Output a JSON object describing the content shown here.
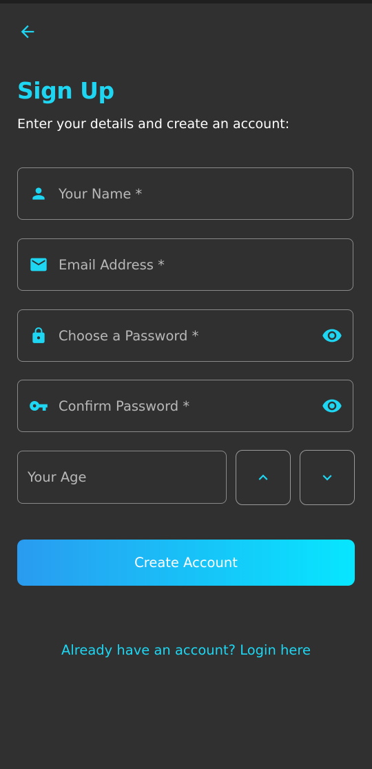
{
  "colors": {
    "background": "#303030",
    "accent": "#1ed6f2",
    "border": "#8a8a8a",
    "placeholder": "#b8b8b8",
    "button_gradient_start": "#2a9bf0",
    "button_gradient_end": "#07e6ff"
  },
  "header": {
    "back_icon": "arrow-left-icon",
    "title": "Sign Up",
    "subtitle": "Enter your details and create an account:"
  },
  "form": {
    "name": {
      "icon": "person-icon",
      "placeholder": "Your Name *",
      "value": ""
    },
    "email": {
      "icon": "mail-icon",
      "placeholder": "Email Address *",
      "value": ""
    },
    "password": {
      "icon": "lock-icon",
      "placeholder": "Choose a Password *",
      "value": "",
      "toggle_icon": "eye-icon"
    },
    "confirm_password": {
      "icon": "key-icon",
      "placeholder": "Confirm Password *",
      "value": "",
      "toggle_icon": "eye-icon"
    },
    "age": {
      "placeholder": "Your Age",
      "value": "",
      "increment_icon": "chevron-up-icon",
      "decrement_icon": "chevron-down-icon"
    }
  },
  "actions": {
    "create_account_label": "Create Account",
    "login_link_label": "Already have an account? Login here"
  }
}
